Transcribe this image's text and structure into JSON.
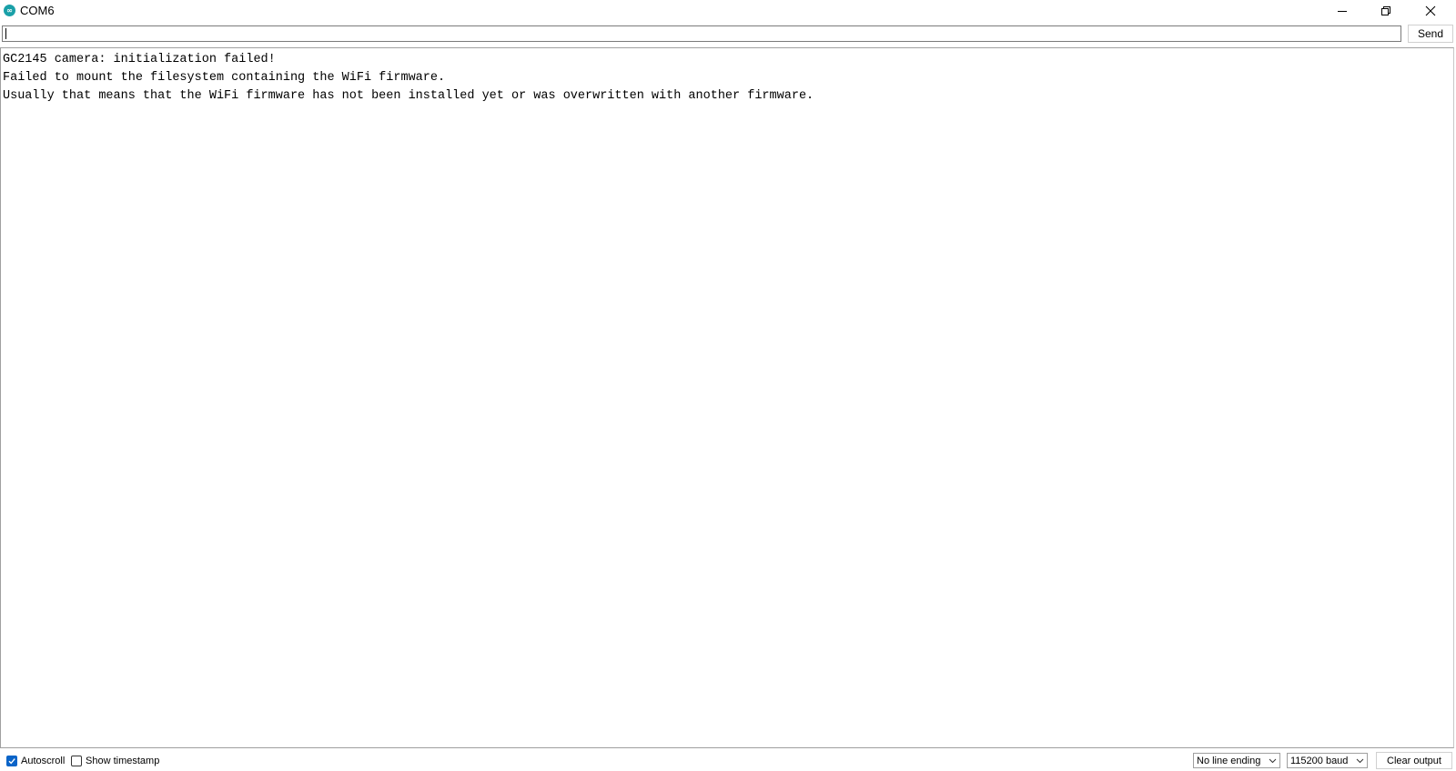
{
  "window": {
    "title": "COM6",
    "icon": "arduino-icon",
    "controls": {
      "minimize_icon": "minimize-icon",
      "maximize_icon": "restore-icon",
      "close_icon": "close-icon"
    }
  },
  "send_bar": {
    "input_value": "",
    "send_label": "Send"
  },
  "output": {
    "lines": [
      "GC2145 camera: initialization failed!",
      "Failed to mount the filesystem containing the WiFi firmware.",
      "Usually that means that the WiFi firmware has not been installed yet or was overwritten with another firmware."
    ]
  },
  "bottom_bar": {
    "autoscroll": {
      "label": "Autoscroll",
      "checked": true
    },
    "show_timestamp": {
      "label": "Show timestamp",
      "checked": false
    },
    "line_ending": {
      "selected": "No line ending"
    },
    "baud_rate": {
      "selected": "115200 baud"
    },
    "clear_label": "Clear output"
  },
  "colors": {
    "accent": "#0a64c8",
    "app_icon": "#1aa0a8"
  }
}
